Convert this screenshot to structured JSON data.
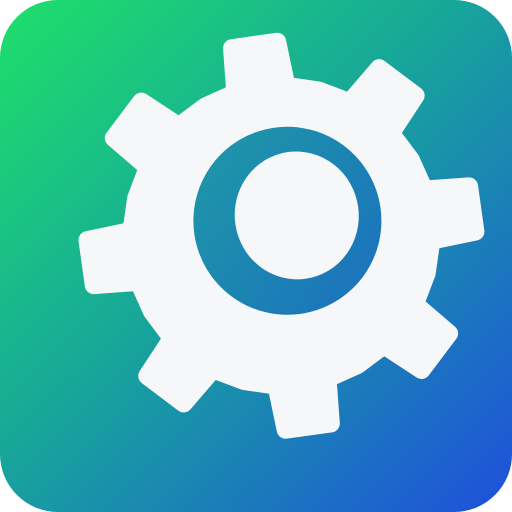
{
  "icon": {
    "name": "gear-icon",
    "colors": {
      "gradient_start": "#1ee06a",
      "gradient_mid": "#17a69a",
      "gradient_end": "#1f4fdc",
      "gear_fill": "#f6f7f9",
      "ring_start": "#1d9aa6",
      "ring_end": "#1c6fbf"
    }
  }
}
